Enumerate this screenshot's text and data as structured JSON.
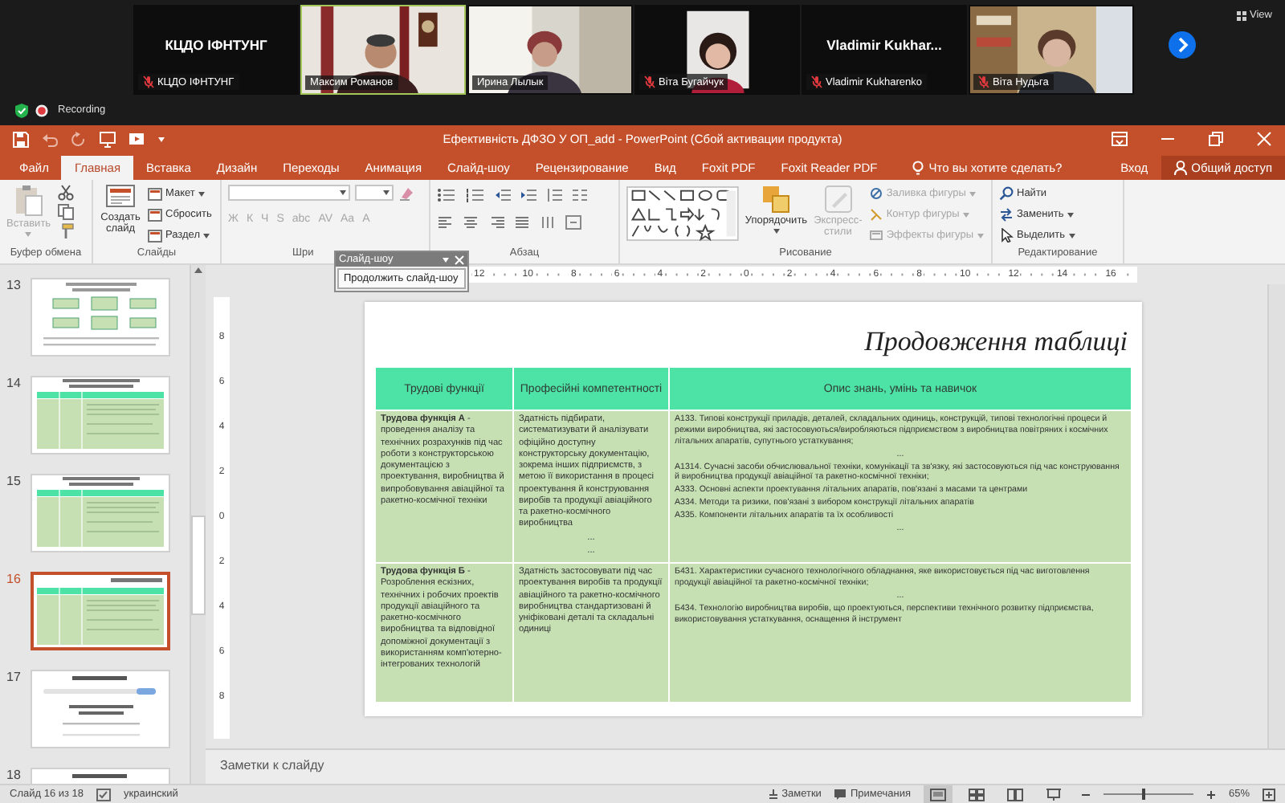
{
  "meeting": {
    "participants": [
      {
        "kind": "name",
        "display_name": "КЦДО ІФНТУНГ",
        "name": "КЦДО ІФНТУНГ",
        "muted": true,
        "speaking": false
      },
      {
        "kind": "video",
        "name": "Максим Романов",
        "muted": false,
        "speaking": true
      },
      {
        "kind": "video",
        "name": "Ирина Лылык",
        "muted": false,
        "speaking": false
      },
      {
        "name": "Віта Бугайчук",
        "muted": true,
        "speaking": false
      },
      {
        "kind": "name",
        "display_name": "Vladimir  Kukhar...",
        "name": "Vladimir Kukharenko",
        "muted": true,
        "speaking": false
      },
      {
        "kind": "video",
        "name": "Віта Нудьга",
        "muted": true,
        "speaking": false
      }
    ],
    "view_button": "View",
    "recording": "Recording"
  },
  "powerpoint": {
    "title": "Ефективність ДФЗО У ОП_add - PowerPoint (Сбой активации продукта)",
    "tabs": [
      {
        "label": "Файл",
        "selected": false
      },
      {
        "label": "Главная",
        "selected": true
      },
      {
        "label": "Вставка",
        "selected": false
      },
      {
        "label": "Дизайн",
        "selected": false
      },
      {
        "label": "Переходы",
        "selected": false
      },
      {
        "label": "Анимация",
        "selected": false
      },
      {
        "label": "Слайд-шоу",
        "selected": false
      },
      {
        "label": "Рецензирование",
        "selected": false
      },
      {
        "label": "Вид",
        "selected": false
      },
      {
        "label": "Foxit PDF",
        "selected": false
      },
      {
        "label": "Foxit Reader PDF",
        "selected": false
      }
    ],
    "tell_me": "Что вы хотите сделать?",
    "sign_in": "Вход",
    "share": "Общий доступ"
  },
  "ribbon": {
    "clipboard": {
      "label": "Буфер обмена",
      "paste": {
        "label": "Вставить",
        "disabled": true
      }
    },
    "slides": {
      "label": "Слайды",
      "new_slide": "Создать слайд",
      "commands": [
        {
          "label": "Макет",
          "menu": true
        },
        {
          "label": "Сбросить",
          "menu": false
        },
        {
          "label": "Раздел",
          "menu": true
        }
      ]
    },
    "font": {
      "label": "Шри",
      "buttons": [
        {
          "label": "Ж",
          "disabled": true
        },
        {
          "label": "К",
          "disabled": true
        },
        {
          "label": "Ч",
          "disabled": true
        },
        {
          "label": "S",
          "disabled": true
        },
        {
          "label": "abc",
          "disabled": true
        },
        {
          "label": "AV",
          "disabled": true
        },
        {
          "label": "Aa",
          "disabled": true
        },
        {
          "label": "A",
          "disabled": true
        }
      ]
    },
    "paragraph": {
      "label": "Абзац"
    },
    "drawing": {
      "label": "Рисование",
      "arrange": "Упорядочить",
      "quick_styles": {
        "label": "Экспресс-стили",
        "disabled": true
      },
      "commands": [
        {
          "label": "Заливка фигуры",
          "disabled": true
        },
        {
          "label": "Контур фигуры",
          "disabled": true
        },
        {
          "label": "Эффекты фигуры",
          "disabled": true
        }
      ]
    },
    "editing": {
      "label": "Редактирование",
      "commands": [
        {
          "kind": "find",
          "label": "Найти",
          "menu": false
        },
        {
          "kind": "replace",
          "label": "Заменить",
          "menu": true
        },
        {
          "kind": "select",
          "label": "Выделить",
          "menu": true
        }
      ]
    }
  },
  "slideshow_toolbar": {
    "title": "Слайд-шоу",
    "button": "Продолжить слайд-шоу"
  },
  "ruler": {
    "horizontal": [
      "12",
      "10",
      "8",
      "6",
      "4",
      "2",
      "0",
      "2",
      "4",
      "6",
      "8",
      "10",
      "12",
      "14",
      "16"
    ],
    "vertical": [
      "8",
      "6",
      "4",
      "2",
      "0",
      "2",
      "4",
      "6",
      "8"
    ]
  },
  "thumbnails": [
    {
      "number": "13",
      "kind": "diagram",
      "selected": false
    },
    {
      "number": "14",
      "kind": "table",
      "selected": false
    },
    {
      "number": "15",
      "kind": "table",
      "selected": false
    },
    {
      "number": "16",
      "kind": "table",
      "selected": true
    },
    {
      "number": "17",
      "kind": "form",
      "selected": false
    },
    {
      "number": "18",
      "kind": "form",
      "selected": false
    }
  ],
  "slide": {
    "title": "Продовження таблиці",
    "table": {
      "columns": [
        "Трудові функції",
        "Професійні компетентності",
        "Опис знань, умінь та навичок"
      ],
      "rows": [
        {
          "cells": [
            {
              "paragraphs": [
                {
                  "text": "**Трудова функція А** - проведення аналізу та технічних розрахунків під час роботи з конструкторською документацією з проектування, виробництва й випробовування авіаційної та ракетно-космічної техніки",
                  "centered": false
                }
              ]
            },
            {
              "paragraphs": [
                {
                  "text": "Здатність підбирати, систематизувати й аналізувати офіційно доступну конструкторську документацію, зокрема інших підприємств, з метою її використання в процесі проектування й конструювання виробів та продукції авіаційного та ракетно-космічного виробництва",
                  "centered": false
                },
                {
                  "text": "...",
                  "centered": true
                },
                {
                  "text": "...",
                  "centered": true
                }
              ]
            },
            {
              "paragraphs": [
                {
                  "text": "А133. Типові конструкції приладів, деталей, складальних одиниць, конструкцій, типові технологічні процеси й режими виробництва, які застосовуються/виробляються підприємством з виробництва повітряних і космічних літальних апаратів, супутнього устаткування;",
                  "centered": false
                },
                {
                  "text": "...",
                  "centered": true
                },
                {
                  "text": "А1314. Сучасні засоби обчислювальної техніки, комунікації та зв'язку, які застосовуються під час конструювання й виробництва продукції авіаційної та ракетно-космічної техніки;",
                  "centered": false
                },
                {
                  "text": "А333. Основні аспекти проектування літальних апаратів, пов'язані з масами та центрами",
                  "centered": false
                },
                {
                  "text": "А334. Методи та ризики, пов'язані з вибором конструкції літальних апаратів",
                  "centered": false
                },
                {
                  "text": "А335. Компоненти літальних апаратів та їх особливості",
                  "centered": false
                },
                {
                  "text": "...",
                  "centered": true
                }
              ]
            }
          ]
        },
        {
          "cells": [
            {
              "paragraphs": [
                {
                  "text": "**Трудова функція Б** - Розроблення ескізних, технічних і робочих проектів продукції авіаційного та ракетно-космічного виробництва та відповідної допоміжної документації з використанням комп'ютерно-інтегрованих технологій",
                  "centered": false
                }
              ]
            },
            {
              "paragraphs": [
                {
                  "text": "Здатність застосовувати під час проектування виробів та продукції авіаційного та ракетно-космічного виробництва стандартизовані й уніфіковані деталі та складальні одиниці",
                  "centered": false
                }
              ]
            },
            {
              "paragraphs": [
                {
                  "text": "Б431. Характеристики сучасного технологічного обладнання, яке використовується під час виготовлення продукції авіаційної та ракетно-космічної техніки;",
                  "centered": false
                },
                {
                  "text": "...",
                  "centered": true
                },
                {
                  "text": "Б434. Технологію виробництва виробів, що проектуються, перспективи технічного розвитку підприємства, використовування устаткування, оснащення й інструмент",
                  "centered": false
                }
              ]
            }
          ]
        }
      ]
    }
  },
  "notes": {
    "placeholder": "Заметки к слайду"
  },
  "status_bar": {
    "slide": "Слайд 16 из 18",
    "language": "украинский",
    "notes": "Заметки",
    "comments": "Примечания",
    "views": [
      {
        "kind": "normal",
        "selected": true
      },
      {
        "kind": "sorter",
        "selected": false
      },
      {
        "kind": "reading",
        "selected": false
      },
      {
        "kind": "slideshow",
        "selected": false
      }
    ],
    "zoom": {
      "level": 0.45
    },
    "zoom_percent": "65%"
  }
}
